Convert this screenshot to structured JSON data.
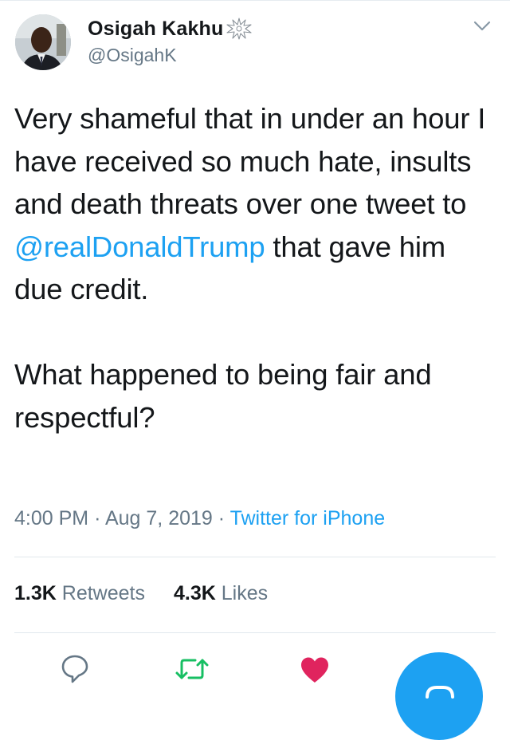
{
  "tweet": {
    "display_name": "Osigah Kakhu",
    "handle": "@OsigahK",
    "verified_icon": "sparkle-burst-icon",
    "text_part1": "Very shameful that in under an hour I have received so much hate, insults and death threats over one tweet to ",
    "mention": "@realDonaldTrump",
    "text_part2": " that gave him due credit.",
    "text_para2": "What happened to being fair and respectful?",
    "time": "4:00 PM",
    "date": "Aug 7, 2019",
    "source": "Twitter for iPhone",
    "separator": "·"
  },
  "stats": {
    "retweets_count": "1.3K",
    "retweets_label": "Retweets",
    "likes_count": "4.3K",
    "likes_label": "Likes"
  },
  "actions": {
    "reply_icon": "reply-bubble-icon",
    "retweet_icon": "retweet-icon",
    "like_icon": "heart-icon",
    "compose_icon": "compose-fab-icon"
  },
  "colors": {
    "accent": "#1da1f2",
    "retweet_green": "#17bf63",
    "like_red": "#e0245e",
    "muted": "#657786"
  }
}
